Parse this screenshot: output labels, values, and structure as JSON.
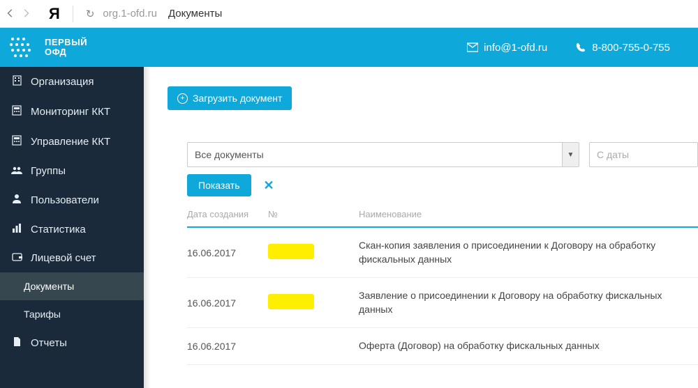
{
  "browser": {
    "host": "org.1-ofd.ru",
    "page_title": "Документы"
  },
  "branding": {
    "logo_line1": "ПЕРВЫЙ",
    "logo_line2": "ОФД"
  },
  "header": {
    "email": "info@1-ofd.ru",
    "phone": "8-800-755-0-755"
  },
  "sidebar": {
    "items": [
      {
        "label": "Организация"
      },
      {
        "label": "Мониторинг ККТ"
      },
      {
        "label": "Управление ККТ"
      },
      {
        "label": "Группы"
      },
      {
        "label": "Пользователи"
      },
      {
        "label": "Статистика"
      },
      {
        "label": "Лицевой счет"
      },
      {
        "label": "Отчеты"
      }
    ],
    "sub": {
      "documents": "Документы",
      "tariffs": "Тарифы"
    }
  },
  "actions": {
    "upload": "Загрузить документ",
    "show": "Показать"
  },
  "filter": {
    "doc_type": "Все документы",
    "date_from_placeholder": "С даты"
  },
  "table": {
    "columns": {
      "date": "Дата создания",
      "number": "№",
      "name": "Наименование"
    },
    "rows": [
      {
        "date": "16.06.2017",
        "number_redacted": true,
        "name": "Скан-копия заявления о присоединении к Договору на обработку фискальных данных"
      },
      {
        "date": "16.06.2017",
        "number_redacted": true,
        "name": "Заявление о присоединении к Договору на обработку фискальных данных"
      },
      {
        "date": "16.06.2017",
        "number_redacted": false,
        "name": "Оферта (Договор) на обработку фискальных данных"
      }
    ]
  }
}
